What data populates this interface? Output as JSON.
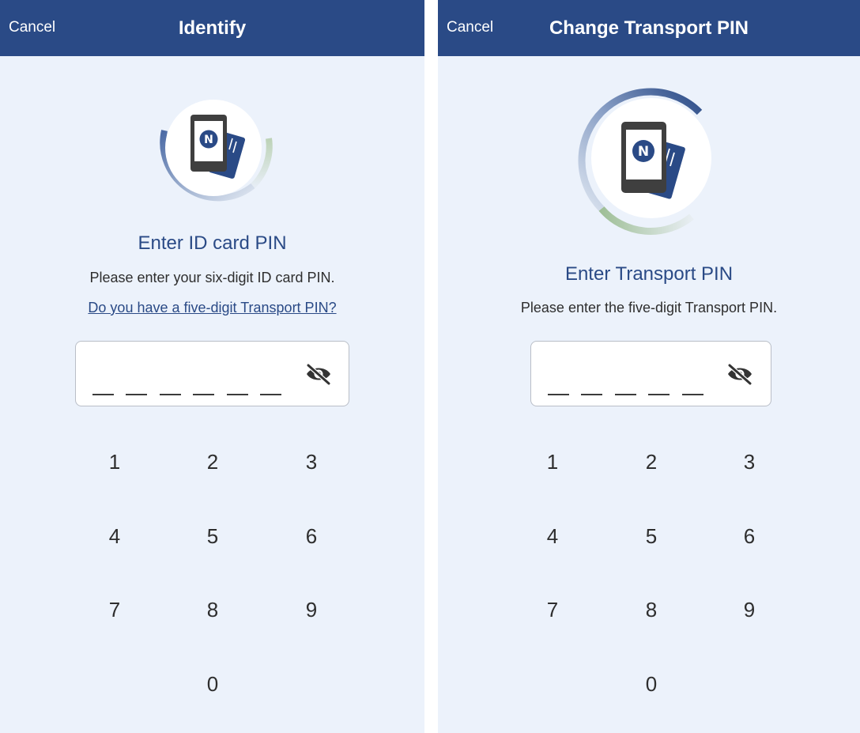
{
  "left_screen": {
    "cancel_label": "Cancel",
    "title": "Identify",
    "heading": "Enter ID card PIN",
    "instruction": "Please enter your six-digit ID card PIN.",
    "link": "Do you have a five-digit Transport PIN?",
    "pin_length": 6,
    "visibility_icon": "eye-slash-icon",
    "keypad": [
      "1",
      "2",
      "3",
      "4",
      "5",
      "6",
      "7",
      "8",
      "9",
      "0"
    ]
  },
  "right_screen": {
    "cancel_label": "Cancel",
    "title": "Change Transport PIN",
    "heading": "Enter Transport PIN",
    "instruction": "Please enter the five-digit Transport PIN.",
    "pin_length": 5,
    "visibility_icon": "eye-slash-icon",
    "keypad": [
      "1",
      "2",
      "3",
      "4",
      "5",
      "6",
      "7",
      "8",
      "9",
      "0"
    ]
  },
  "colors": {
    "header_bg": "#2a4a86",
    "screen_bg": "#ecf2fb",
    "accent": "#2a4a86",
    "progress_green": "#9fbf97",
    "device_dark": "#3f3f3f"
  }
}
